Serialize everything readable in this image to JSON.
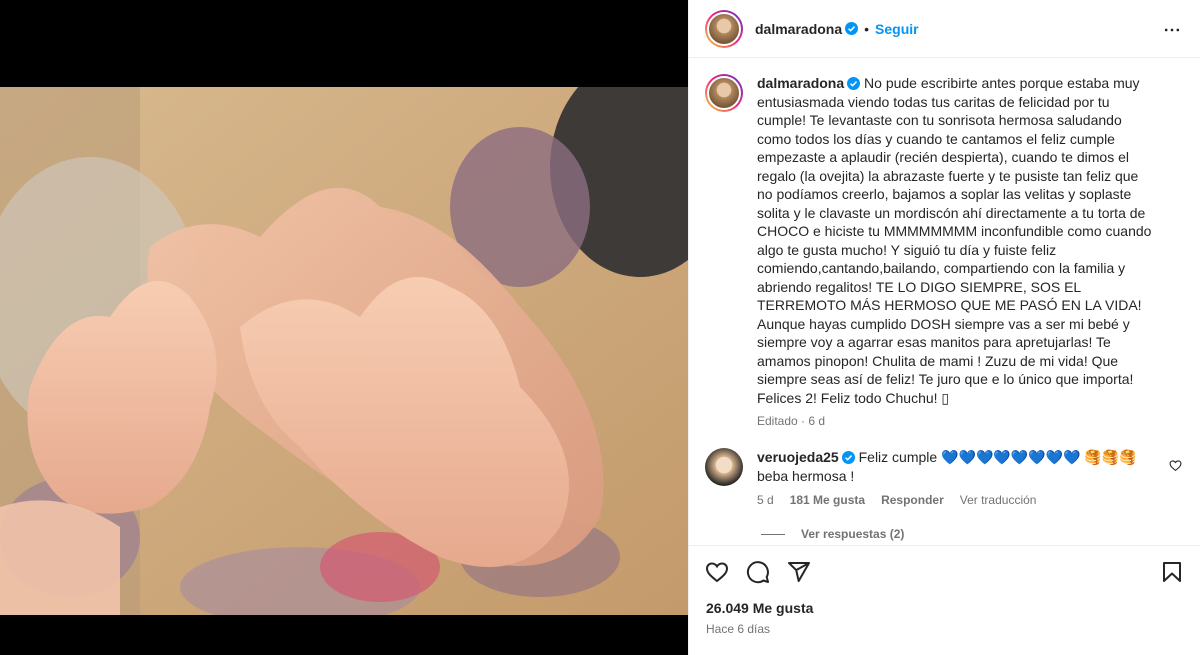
{
  "header": {
    "username": "dalmaradona",
    "separator": "•",
    "follow_label": "Seguir"
  },
  "caption": {
    "username": "dalmaradona",
    "text": "No pude escribirte antes porque estaba muy entusiasmada viendo todas tus caritas de felicidad por tu cumple! Te levantaste con tu sonrisota hermosa saludando como todos los días y cuando te cantamos el feliz cumple empezaste a aplaudir (recién despierta), cuando te dimos el regalo (la ovejita) la abrazaste fuerte y te pusiste tan feliz que no podíamos creerlo, bajamos a soplar las velitas y soplaste solita y le clavaste un mordiscón ahí directamente a tu torta de CHOCO e hiciste tu MMMMMMMM inconfundible como cuando algo te gusta mucho! Y siguió tu día y fuiste feliz comiendo,cantando,bailando, compartiendo con la familia y abriendo regalitos! TE LO DIGO SIEMPRE, SOS EL TERREMOTO MÁS HERMOSO QUE ME PASÓ EN LA VIDA! Aunque hayas cumplido DOSH siempre vas a ser mi bebé y siempre voy a agarrar esas manitos para apretujarlas! Te amamos pinopon! Chulita de mami ! Zuzu de mi vida! Que siempre seas así de feliz! Te juro que e lo único que importa! Felices 2! Feliz todo Chuchu! ▯",
    "edited": "Editado",
    "dot": "·",
    "age": "6 d"
  },
  "comment": {
    "username": "veruojeda25",
    "text": "Feliz cumple 💙💙💙💙💙💙💙💙 🥞🥞🥞beba hermosa !",
    "age": "5 d",
    "likes": "181 Me gusta",
    "reply_label": "Responder",
    "translate_label": "Ver traducción",
    "view_replies": "Ver respuestas (2)"
  },
  "footer": {
    "likes": "26.049 Me gusta",
    "time": "Hace 6 días"
  },
  "icons": {
    "like": "heart-icon",
    "comment": "comment-icon",
    "share": "share-icon",
    "save": "bookmark-icon",
    "more": "more-icon",
    "verified": "verified-badge-icon"
  },
  "colors": {
    "accent": "#0095f6",
    "verified": "#0095f6",
    "muted": "#737373",
    "text": "#262626"
  }
}
